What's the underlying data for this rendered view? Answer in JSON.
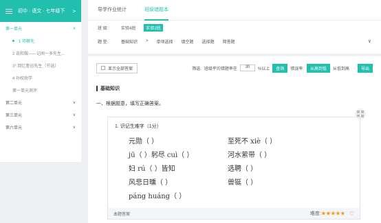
{
  "sidebar": {
    "title": "初中 · 语文 · 七年级下",
    "arrow": ">",
    "units": [
      {
        "label": "第一单元",
        "icon": "∧",
        "lessons": [
          "1 邓稼先",
          "2 说和做——记闻一多先生...",
          "3* 回忆鲁迅先生（节选）",
          "4 孙权劝学",
          "第一单元测评"
        ]
      },
      {
        "label": "第二单元",
        "icon": "∨"
      },
      {
        "label": "第三单元",
        "icon": "∨"
      },
      {
        "label": "第六单元",
        "icon": "∨"
      }
    ]
  },
  "tabs": [
    "导学作业统计",
    "班级错题本"
  ],
  "filters": {
    "class_label": "班 级:",
    "class_opts": [
      "实验4班",
      "实验2班"
    ],
    "type_label": "题 型:",
    "type_opts": [
      "基础知识",
      ">",
      "单项选择",
      "填空题",
      "选择题",
      "简答题"
    ],
    "expand": "∨"
  },
  "controls": {
    "show_all": "显示全部答案",
    "filter": "筛选:",
    "rate_label": "班级平均错题率在",
    "rate_value": "30",
    "rate_suffix": "%以上",
    "query": "查询",
    "sort_label": "错误率:",
    "sort_btn": "从高到低",
    "sort_alt": "从低到高",
    "export": "导出"
  },
  "section": "基础知识",
  "instruction": "一、根据题意，填写正确答案。",
  "question": {
    "head": "1. 识记生难字（1分）",
    "items": [
      "元勋（   ）",
      "至死不 xiè（   ）",
      "jū（   ）躬尽 cuì（   ）",
      "河水萦带（   ）",
      "妇 rú（   ）皆知",
      "选聘（   ）",
      "风悲日曛（   ）",
      "兽铤（   ）",
      "páng huáng（   ）",
      ""
    ],
    "answer": "本题答案",
    "difficulty": "难度:",
    "stars": "★★★★★",
    "heart": "♡"
  }
}
